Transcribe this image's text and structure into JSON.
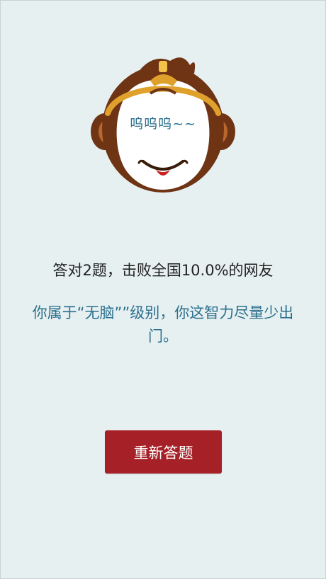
{
  "result": {
    "mascot_caption": "呜呜呜~~",
    "score_text": "答对2题，击败全国10.0%的网友",
    "comment_text": "你属于“无脑””级别，你这智力尽量少出门。"
  },
  "actions": {
    "retry_label": "重新答题"
  },
  "colors": {
    "background": "#e6f0f1",
    "accent_text": "#2b6f8d",
    "button": "#a52027",
    "fur": "#6e3414",
    "headband": "#e0a12c"
  },
  "icons": {
    "mascot": "monkey-face-icon"
  }
}
